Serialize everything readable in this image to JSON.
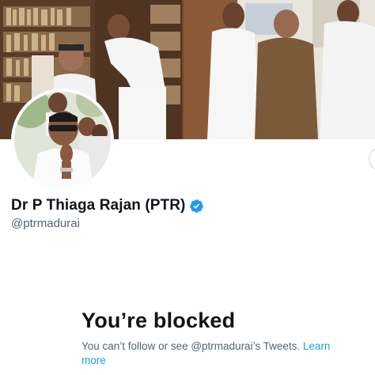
{
  "profile": {
    "display_name": "Dr P Thiaga Rajan (PTR)",
    "handle": "@ptrmadurai",
    "verified": true,
    "verified_icon": "verified-badge-icon",
    "accent_color": "#1d9bf0"
  },
  "blocked_notice": {
    "title": "You’re blocked",
    "body_prefix": "You can’t follow or see @ptrmadurai’s Tweets.",
    "learn_more_label": "Learn more"
  }
}
